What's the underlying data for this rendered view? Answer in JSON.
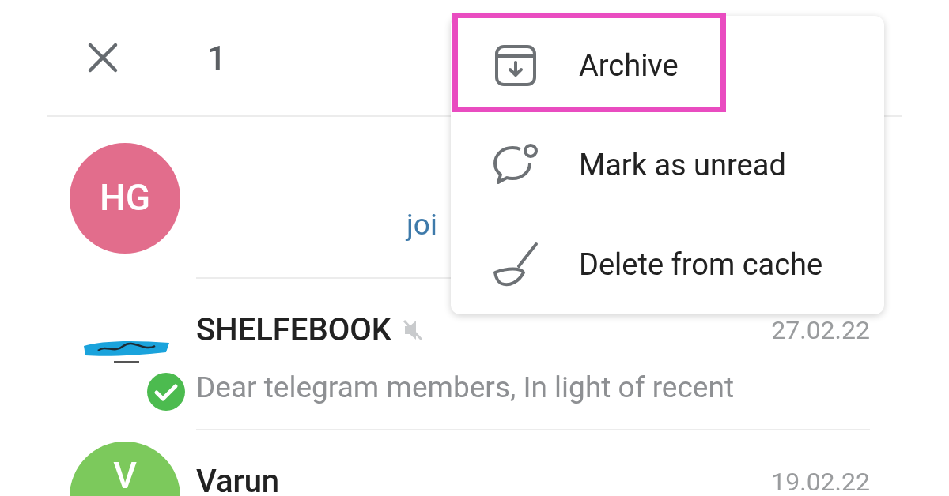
{
  "header": {
    "selected_count": "1"
  },
  "chats": [
    {
      "kind": "initials",
      "initials": "HG",
      "color": "#e26d8c",
      "preview": "joi",
      "link_preview": true
    },
    {
      "kind": "logo",
      "name": "SHELFEBOOK",
      "muted": true,
      "verified": true,
      "date": "27.02.22",
      "preview": "Dear telegram members,  In light of recent",
      "link_preview": false
    },
    {
      "kind": "initials",
      "initials": "V",
      "color": "#7cc95c",
      "name": "Varun",
      "muted": false,
      "verified": false,
      "date": "19.02.22"
    }
  ],
  "menu": {
    "items": [
      {
        "kind": "archive",
        "label": "Archive",
        "highlighted": true
      },
      {
        "kind": "unread",
        "label": "Mark as unread",
        "highlighted": false
      },
      {
        "kind": "broom",
        "label": "Delete from cache",
        "highlighted": false
      }
    ]
  }
}
